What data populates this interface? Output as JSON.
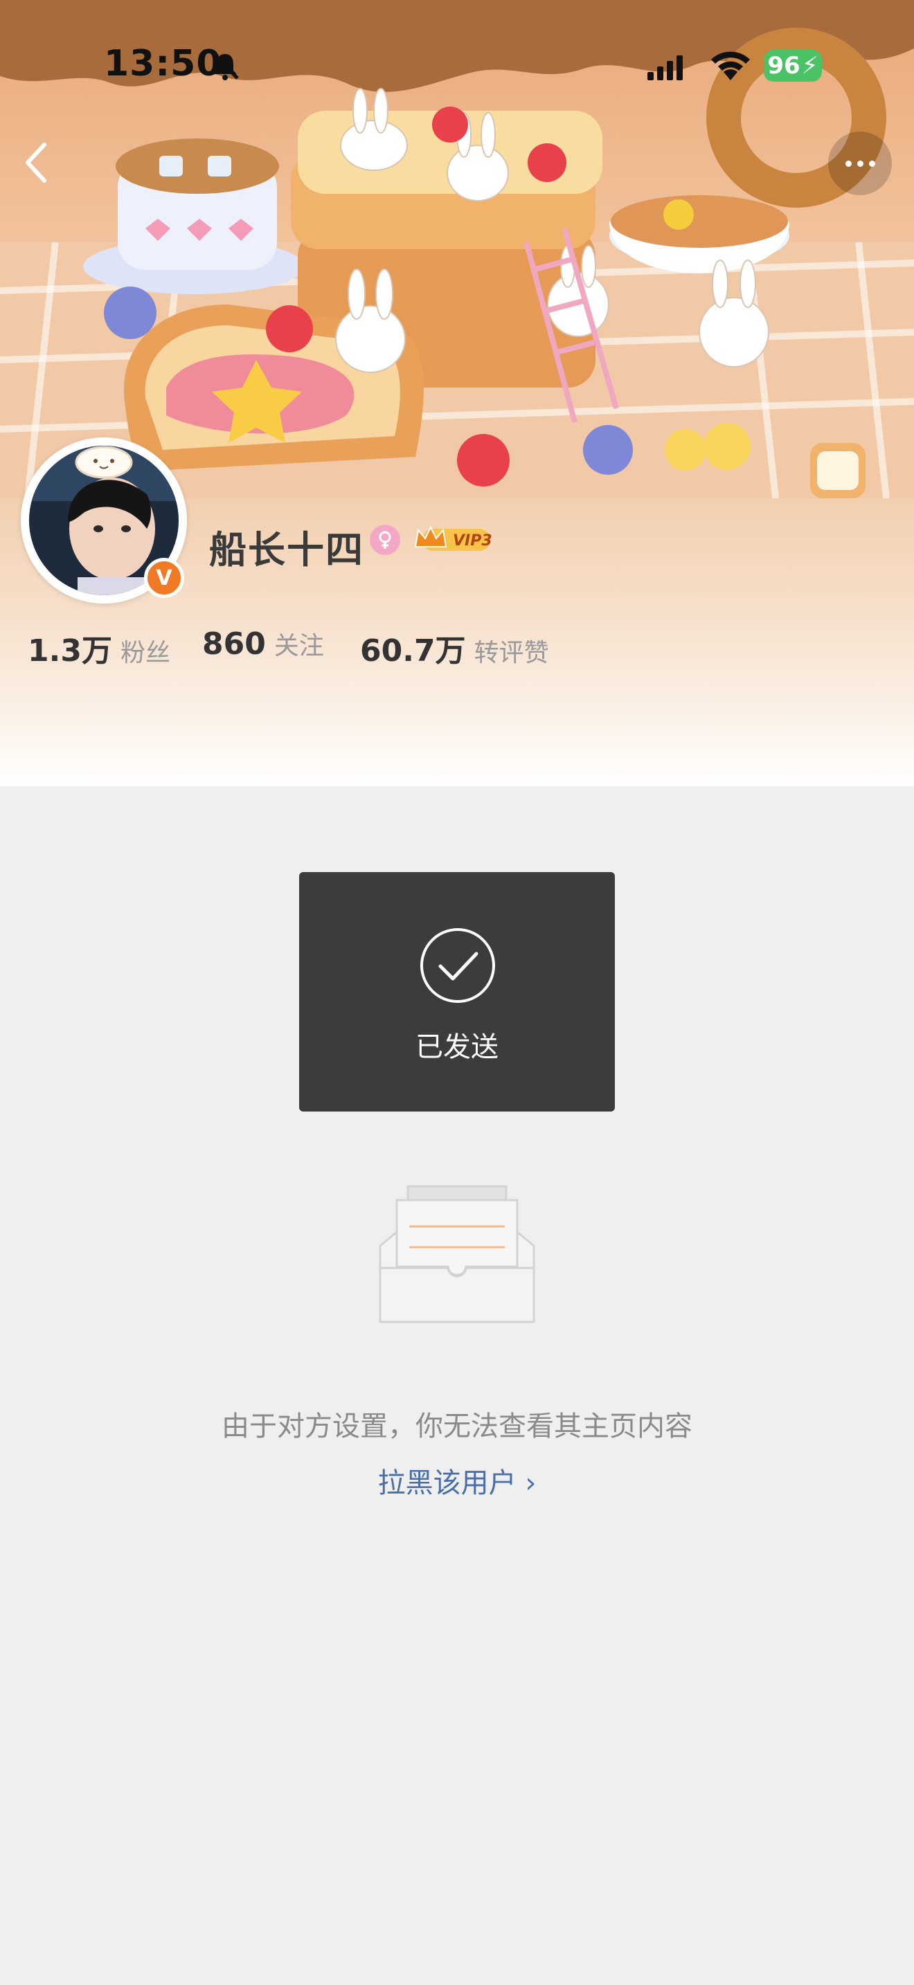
{
  "status_bar": {
    "time": "13:50",
    "battery": "96",
    "icons": [
      "bell-mute-icon",
      "signal-icon",
      "wifi-icon",
      "battery-charging-icon"
    ]
  },
  "nav": {
    "back_icon": "chevron-left-icon",
    "more_icon": "ellipsis-icon"
  },
  "profile": {
    "name": "船长十四",
    "gender_icon": "female-icon",
    "vip_label": "VIP3",
    "verified_mark": "V",
    "stats": [
      {
        "value": "1.3万",
        "label": "粉丝"
      },
      {
        "value": "860",
        "label": "关注"
      },
      {
        "value": "60.7万",
        "label": "转评赞"
      }
    ]
  },
  "toast": {
    "text": "已发送",
    "icon": "check-circle-icon"
  },
  "empty_state": {
    "icon": "empty-inbox-icon",
    "message": "由于对方设置，你无法查看其主页内容",
    "action": "拉黑该用户 ›"
  },
  "colors": {
    "accent_orange": "#f07a26",
    "link_blue": "#4a6fa8",
    "toast_bg": "#3c3c3c",
    "battery_green": "#4cc266",
    "page_bg": "#efefef"
  }
}
